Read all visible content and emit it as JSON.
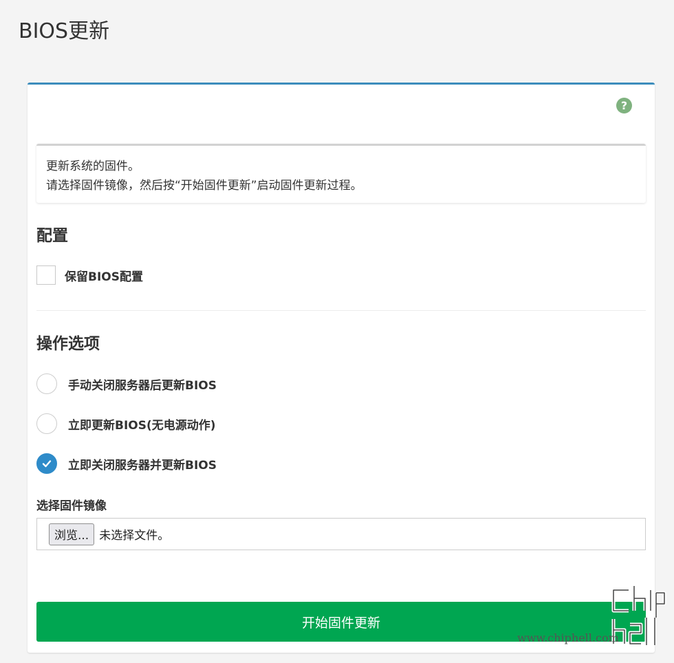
{
  "page": {
    "title": "BIOS更新"
  },
  "card": {
    "help_icon": "?",
    "info": {
      "line1": "更新系统的固件。",
      "line2": "请选择固件镜像，然后按“开始固件更新”启动固件更新过程。"
    },
    "config": {
      "title": "配置",
      "keep_bios_label": "保留BIOS配置",
      "keep_bios_checked": false
    },
    "actions": {
      "title": "操作选项",
      "options": [
        {
          "label": "手动关闭服务器后更新BIOS",
          "checked": false
        },
        {
          "label": "立即更新BIOS(无电源动作)",
          "checked": false
        },
        {
          "label": "立即关闭服务器并更新BIOS",
          "checked": true
        }
      ]
    },
    "file": {
      "label": "选择固件镜像",
      "browse_label": "浏览...",
      "status": "未选择文件。"
    },
    "start_button_label": "开始固件更新"
  },
  "watermark": {
    "text": "www.chiphell.com",
    "logo_text": "chip hell"
  },
  "colors": {
    "accent": "#3c8dbc",
    "radio_checked": "#2e8bc9",
    "primary_button": "#00a651",
    "help_icon": "#7fb27f"
  },
  "icons": [
    "question-circle-icon",
    "check-icon"
  ]
}
